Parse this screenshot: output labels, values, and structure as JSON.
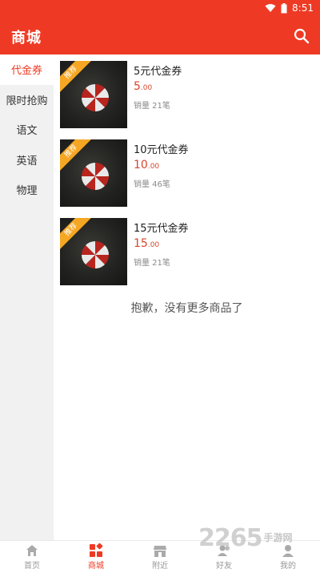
{
  "status": {
    "time": "8:51"
  },
  "header": {
    "title": "商城"
  },
  "sidebar": {
    "items": [
      {
        "label": "代金券"
      },
      {
        "label": "限时抢购"
      },
      {
        "label": "语文"
      },
      {
        "label": "英语"
      },
      {
        "label": "物理"
      }
    ]
  },
  "products": [
    {
      "badge": "推荐",
      "name": "5元代金券",
      "price_int": "5",
      "price_dec": ".00",
      "sales_label": "销量 21笔"
    },
    {
      "badge": "推荐",
      "name": "10元代金券",
      "price_int": "10",
      "price_dec": ".00",
      "sales_label": "销量 46笔"
    },
    {
      "badge": "推荐",
      "name": "15元代金券",
      "price_int": "15",
      "price_dec": ".00",
      "sales_label": "销量 21笔"
    }
  ],
  "no_more": "抱歉，没有更多商品了",
  "bottom_nav": [
    {
      "label": "首页",
      "icon": "home-icon"
    },
    {
      "label": "商城",
      "icon": "grid-icon"
    },
    {
      "label": "附近",
      "icon": "store-icon"
    },
    {
      "label": "好友",
      "icon": "friends-icon"
    },
    {
      "label": "我的",
      "icon": "profile-icon"
    }
  ],
  "watermark": {
    "main": "2265",
    "sub": "手游网"
  },
  "colors": {
    "accent": "#ee3a24",
    "badge": "#f5a623",
    "price": "#d9452b"
  }
}
